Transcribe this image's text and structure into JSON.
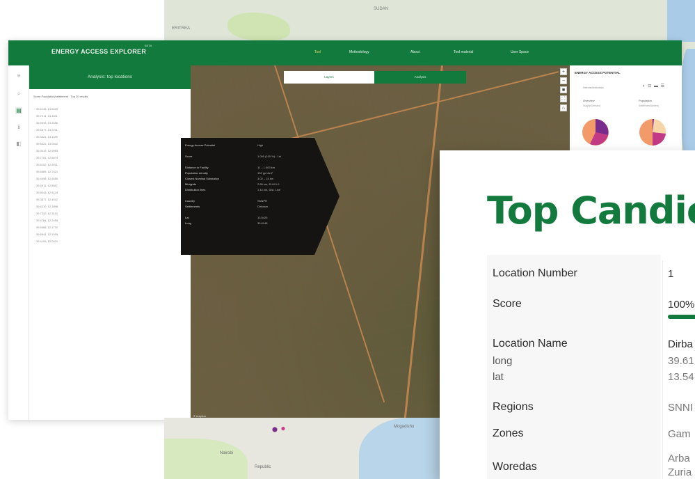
{
  "background_map": {
    "labels": [
      "SUDAN",
      "ERITREA",
      "Mogadishu",
      "Nairobi",
      "Republic"
    ]
  },
  "app": {
    "brand": "ENERGY ACCESS EXPLORER",
    "brand_sup": "BETA",
    "nav": [
      "Tool",
      "Methodology",
      "About",
      "Tool material",
      "User Space"
    ],
    "active_nav": "Tool",
    "panel": {
      "title": "Analysis: top locations",
      "subtitle": "Score Population/settlement · Top 20 results",
      "items": [
        "39.6148, 13.5425",
        "39.7214, 13.4811",
        "39.5533, 13.3096",
        "39.6877, 13.2211",
        "39.4321, 13.1189",
        "39.8422, 13.0542",
        "39.3015, 12.9983",
        "39.7751, 12.8874",
        "39.5102, 12.8011",
        "39.6689, 12.7421",
        "39.4498, 12.6650",
        "39.5911, 12.5987",
        "39.8043, 12.5124",
        "39.3877, 12.4512",
        "39.6210, 12.3898",
        "39.7332, 12.3101",
        "39.4764, 12.2455",
        "39.5588, 12.1732",
        "39.6941, 12.1009",
        "39.4105, 12.0421"
      ]
    },
    "map": {
      "toggle": [
        "Layers",
        "Analysis"
      ],
      "attribution": "© mapbox"
    },
    "popup": {
      "rows": [
        {
          "label": "Energy Access Potential",
          "value": "High"
        },
        {
          "label": "Score",
          "value": "1.000 (100 %) · 1st"
        },
        {
          "label": "Distance to Facility",
          "value": "11 – 1.003 km"
        },
        {
          "label": "Population density",
          "value": "132 ppl /km²"
        },
        {
          "label": "Closest Nominal Substation",
          "value": "3.02 – 24 km"
        },
        {
          "label": "Minigrids",
          "value": "2.89 km, ELM 0.0"
        },
        {
          "label": "Distribution lines",
          "value": "1.14 km, Dist. Line"
        },
        {
          "label": "Country",
          "value": "SNNPR"
        },
        {
          "label": "Settlements",
          "value": "Dirbaam"
        },
        {
          "label": "Lat",
          "value": "13.5425"
        },
        {
          "label": "Long",
          "value": "39.6148"
        }
      ]
    },
    "eap": {
      "title": "ENERGY ACCESS POTENTIAL",
      "subtitle": "Selected indicators",
      "icons": "◐ ⊡ ▬ ☰",
      "columns": [
        {
          "name": "Overview",
          "sub": "Supply/Demand"
        },
        {
          "name": "Population",
          "sub": "Settlement/Access"
        }
      ],
      "pie_colors": [
        "#f39a6b",
        "#7a2c8c",
        "#c23a85",
        "#f6d6a8"
      ]
    }
  },
  "card": {
    "title": "Top Candic",
    "rows": [
      {
        "label": "Location Number",
        "value": "1"
      },
      {
        "label": "Score",
        "value": "100%"
      },
      {
        "label": "Location Name",
        "value": "Dirba"
      },
      {
        "label": "long",
        "value": "39.61"
      },
      {
        "label": "lat",
        "value": "13.54"
      },
      {
        "label": "Regions",
        "value": "SNNI"
      },
      {
        "label": "Zones",
        "value": "Gam"
      },
      {
        "label": "Woredas",
        "value": "Arba"
      },
      {
        "label": "",
        "value": "Zuria"
      }
    ],
    "score_fraction": 1.0
  },
  "colors": {
    "brand_green": "#127a3c",
    "popup_bg": "#161412",
    "active_nav": "#e8d35a"
  }
}
